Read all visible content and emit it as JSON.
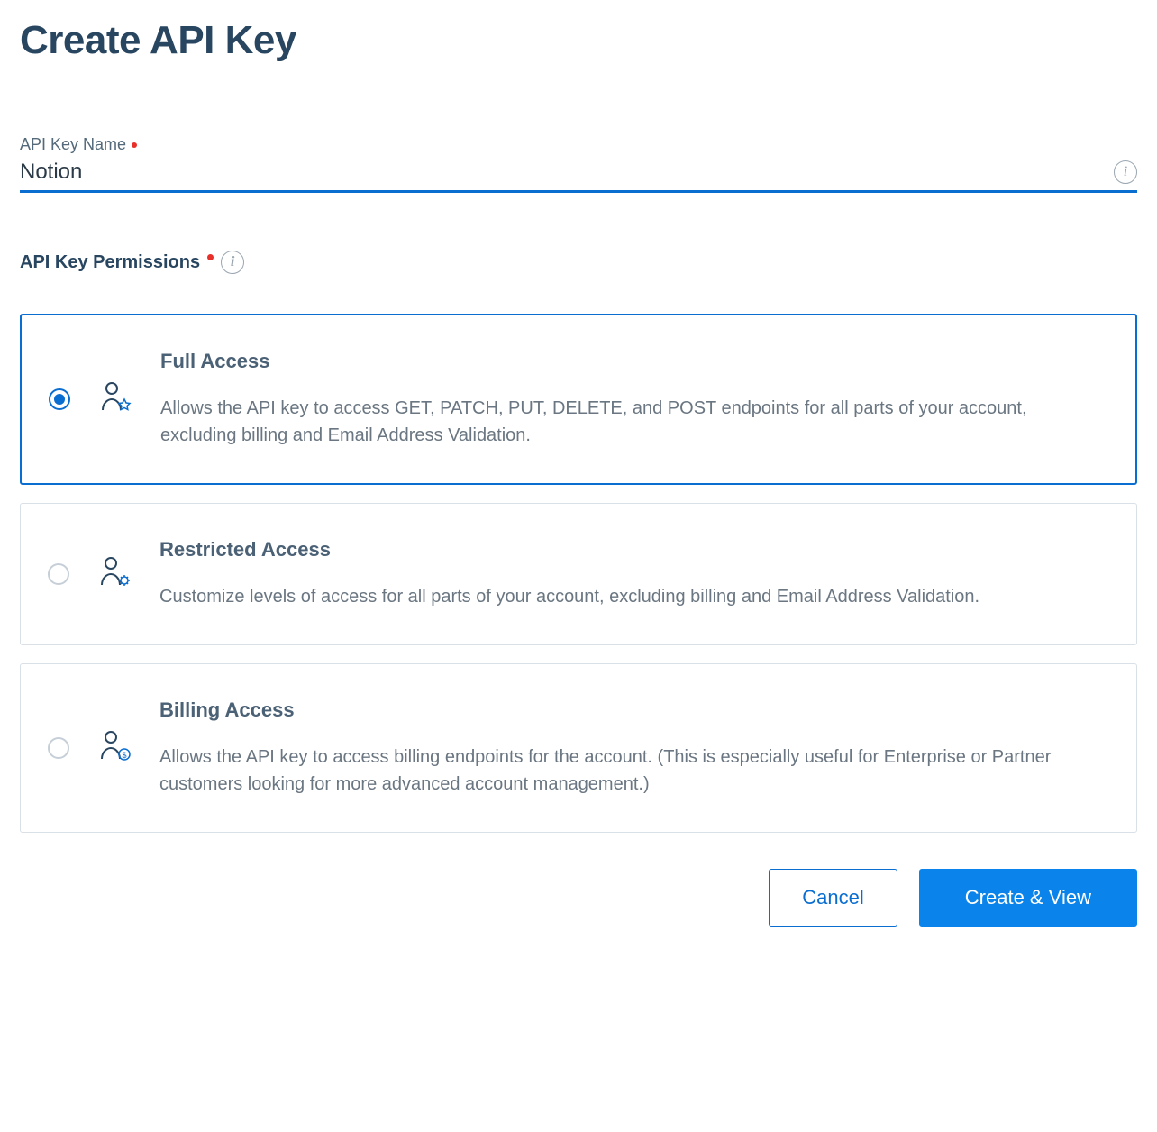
{
  "page": {
    "title": "Create API Key"
  },
  "nameField": {
    "label": "API Key Name",
    "value": "Notion",
    "required": true
  },
  "permissions": {
    "label": "API Key Permissions",
    "required": true,
    "options": [
      {
        "id": "full",
        "title": "Full Access",
        "description": "Allows the API key to access GET, PATCH, PUT, DELETE, and POST endpoints for all parts of your account, excluding billing and Email Address Validation.",
        "selected": true,
        "icon": "user-star"
      },
      {
        "id": "restricted",
        "title": "Restricted Access",
        "description": "Customize levels of access for all parts of your account, excluding billing and Email Address Validation.",
        "selected": false,
        "icon": "user-gear"
      },
      {
        "id": "billing",
        "title": "Billing Access",
        "description": "Allows the API key to access billing endpoints for the account. (This is especially useful for Enterprise or Partner customers looking for more advanced account management.)",
        "selected": false,
        "icon": "user-dollar"
      }
    ]
  },
  "actions": {
    "cancel": "Cancel",
    "submit": "Create & View"
  },
  "colors": {
    "accent": "#0a6ed1",
    "primaryBtn": "#0a84ea",
    "heading": "#294661",
    "required": "#e8302a"
  }
}
